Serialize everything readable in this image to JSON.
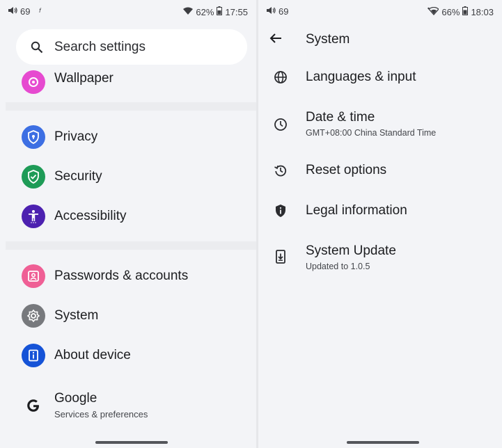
{
  "left": {
    "status": {
      "volume": "69",
      "extra": "ᶠ",
      "battery": "62%",
      "time": "17:55"
    },
    "search": {
      "placeholder": "Search settings"
    },
    "items": [
      {
        "label": "Wallpaper",
        "icon": "wallpaper-icon",
        "color": "#e64ad0"
      },
      {
        "label": "Privacy",
        "icon": "privacy-icon",
        "color": "#3d6fe3"
      },
      {
        "label": "Security",
        "icon": "security-icon",
        "color": "#1e9b57"
      },
      {
        "label": "Accessibility",
        "icon": "accessibility-icon",
        "color": "#4c21b0"
      },
      {
        "label": "Passwords & accounts",
        "icon": "passwords-icon",
        "color": "#ef5f95"
      },
      {
        "label": "System",
        "icon": "system-icon",
        "color": "#77797d"
      },
      {
        "label": "About device",
        "icon": "about-icon",
        "color": "#1553d7"
      },
      {
        "label": "Google",
        "sublabel": "Services & preferences",
        "icon": "google-icon"
      }
    ]
  },
  "right": {
    "status": {
      "volume": "69",
      "battery": "66%",
      "time": "18:03"
    },
    "title": "System",
    "items": [
      {
        "label": "Languages & input",
        "icon": "globe-icon"
      },
      {
        "label": "Date & time",
        "sublabel": "GMT+08:00 China Standard Time",
        "icon": "clock-icon"
      },
      {
        "label": "Reset options",
        "icon": "reset-icon"
      },
      {
        "label": "Legal information",
        "icon": "legal-shield-icon"
      },
      {
        "label": "System Update",
        "sublabel": "Updated to  1.0.5",
        "icon": "system-update-icon"
      }
    ]
  }
}
